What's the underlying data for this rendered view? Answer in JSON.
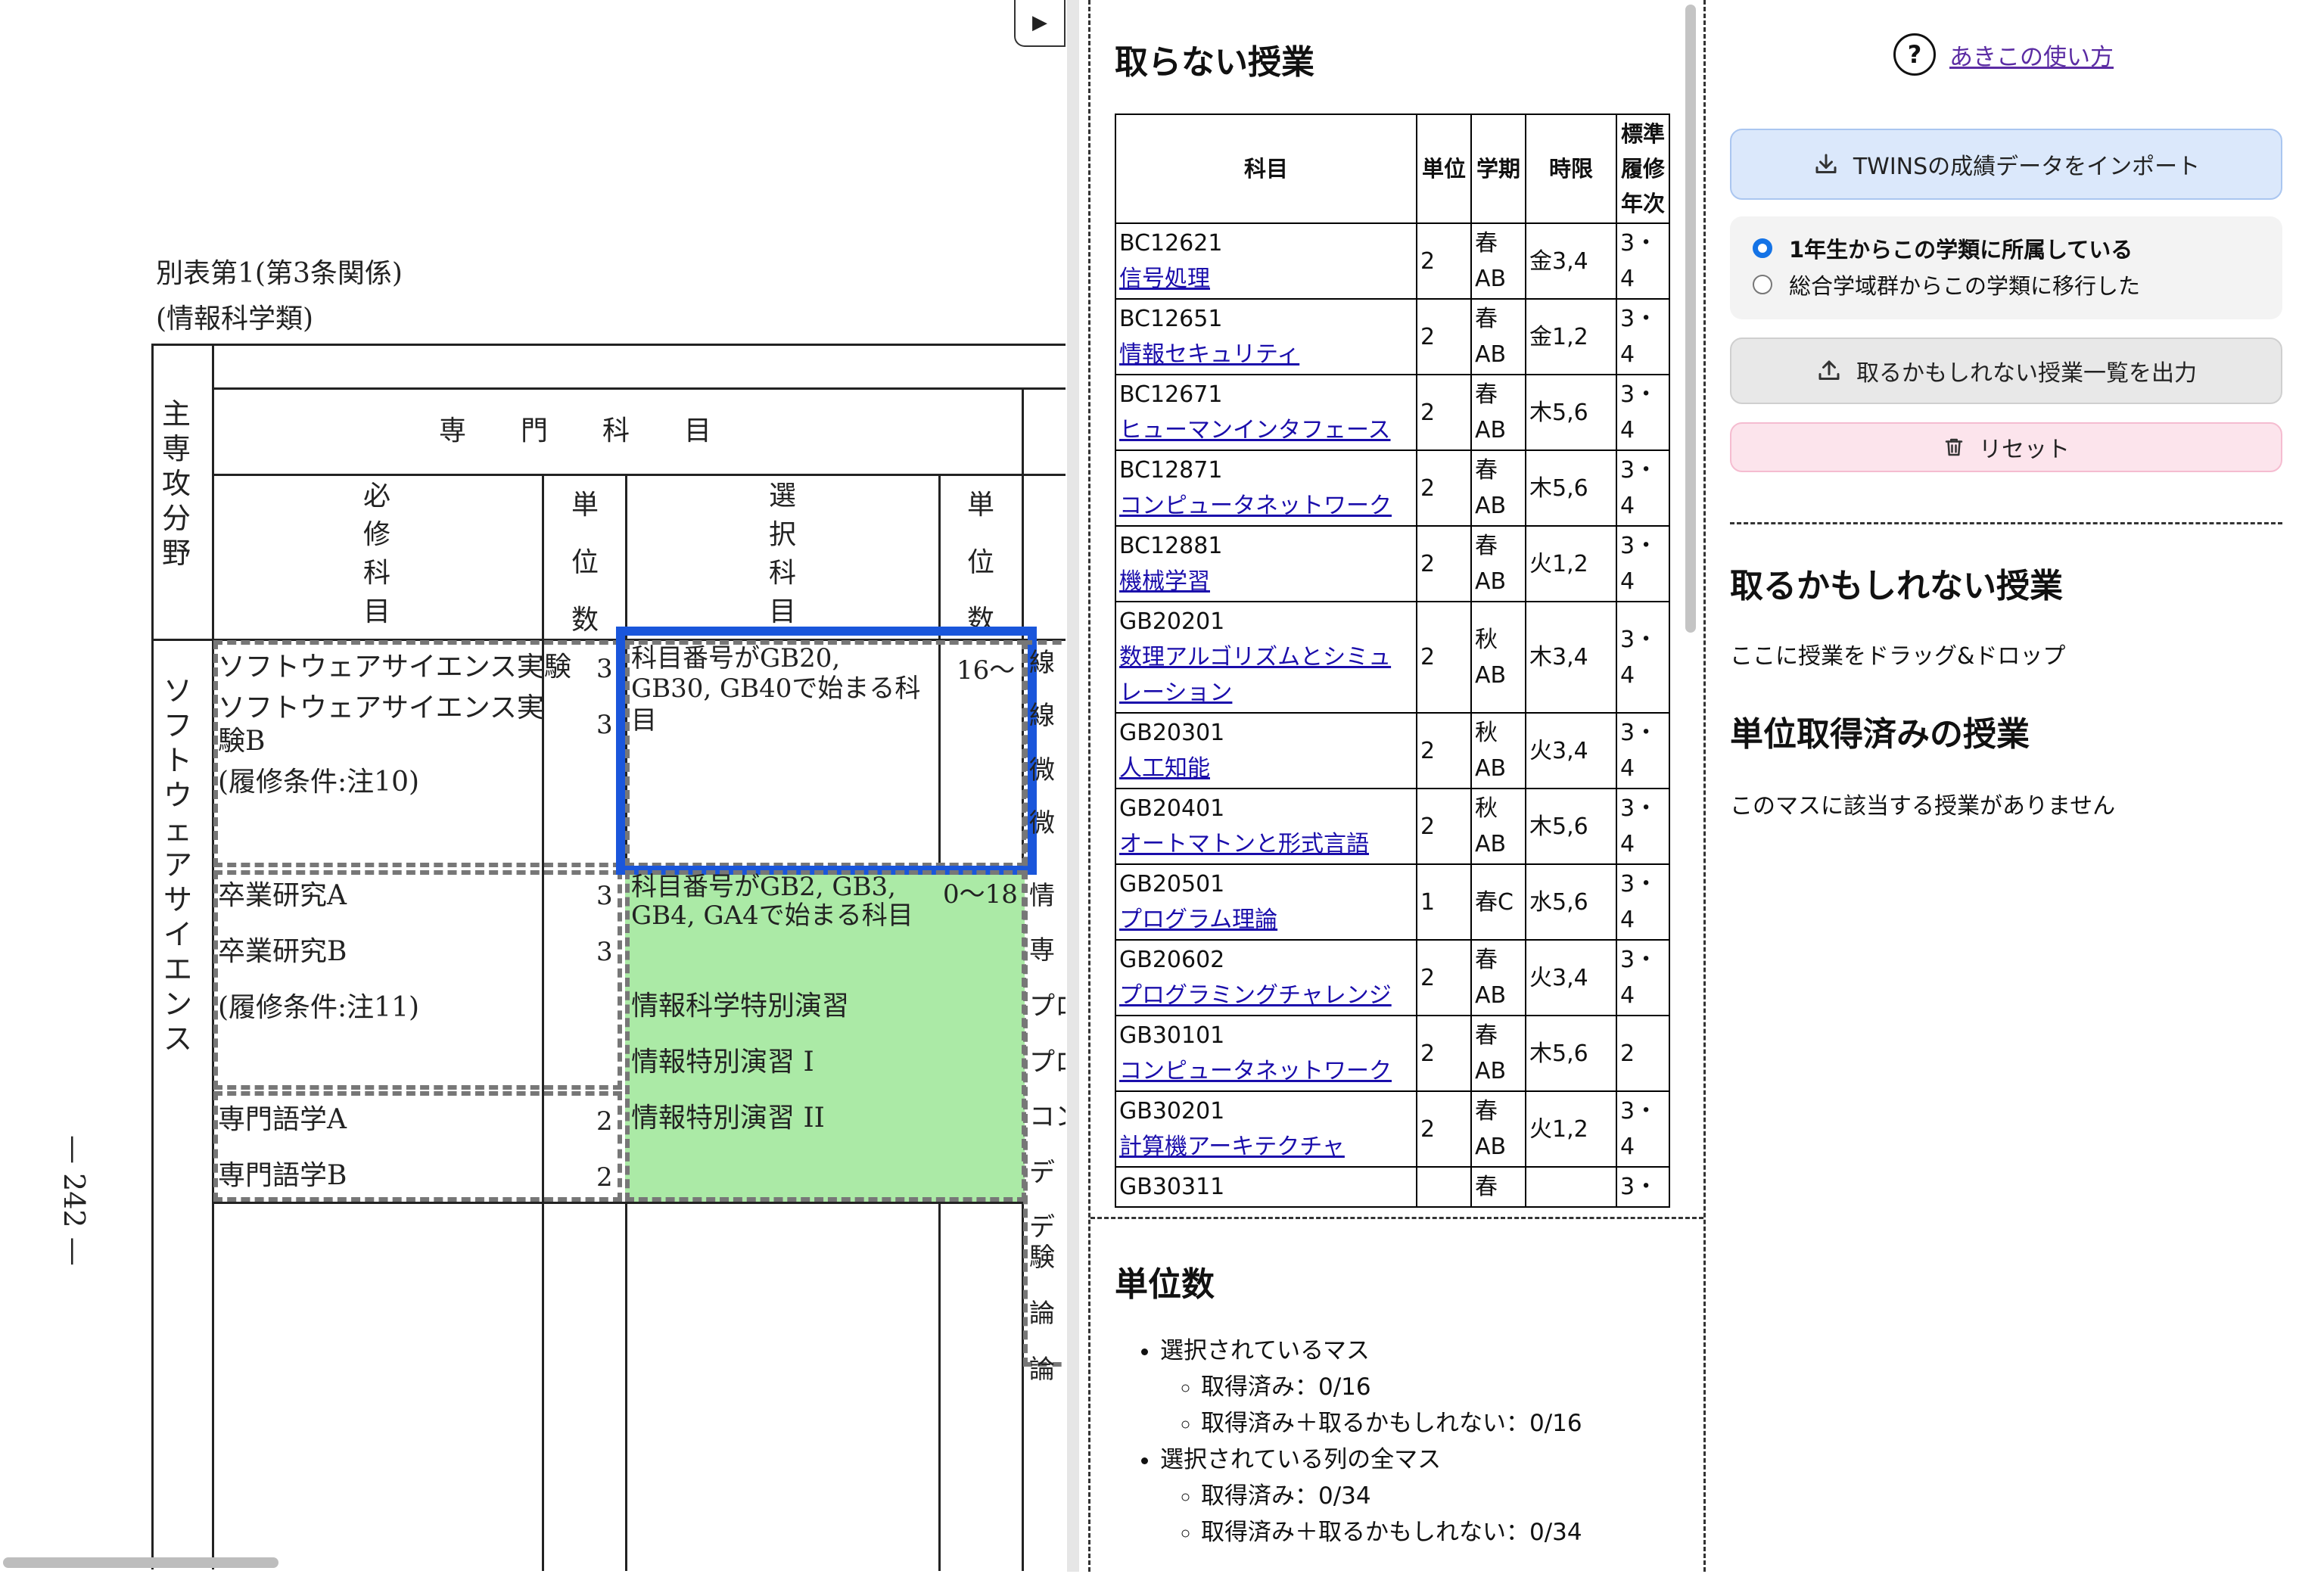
{
  "document": {
    "caption_line1": "別表第1(第3条関係)",
    "caption_line2": "(情報科学類)",
    "header_major": "主専攻分野",
    "header_specialized": "専　　門　　科　　目",
    "header_required": "必修科目",
    "header_units": "単位数",
    "header_elective": "選択科目",
    "major_name": "ソフトウェアサイエンス",
    "page_number": "— 242 —",
    "required_row1": {
      "line1": "ソフトウェアサイエンス実験",
      "line2": "ソフトウェアサイエンス実",
      "line3": "験B",
      "condition": "(履修条件:注10)",
      "units1": "3",
      "units2": "3"
    },
    "required_row2": {
      "line1": "卒業研究A",
      "line2": "卒業研究B",
      "condition": "(履修条件:注11)",
      "units1": "3",
      "units2": "3"
    },
    "required_row3": {
      "line1": "専門語学A",
      "line2": "専門語学B",
      "units1": "2",
      "units2": "2"
    },
    "elective_row1": {
      "line1": "科目番号がGB20,",
      "line2": "GB30, GB40で始まる科",
      "line3": "目",
      "units": "16〜"
    },
    "elective_row2": {
      "line1": "科目番号がGB2, GB3,",
      "line2": "GB4, GA4で始まる科目",
      "line3": "情報科学特別演習",
      "line4": "情報特別演習 I",
      "line5": "情報特別演習 II",
      "units": "0〜18"
    },
    "clipped_col": [
      "線",
      "線",
      "微",
      "微",
      "情",
      "専",
      "プロ",
      "プロ",
      "コン",
      "デ",
      "デ",
      "験",
      "論",
      "論"
    ],
    "collapse_glyph": "▶"
  },
  "untaken": {
    "title": "取らない授業",
    "headers": [
      "科目",
      "単位",
      "学期",
      "時限",
      "標準",
      "履修",
      "年次"
    ],
    "rows": [
      {
        "code": "BC12621",
        "name": "信号処理",
        "units": "2",
        "term1": "春",
        "term2": "AB",
        "period": "金3,4",
        "year1": "3・",
        "year2": "4"
      },
      {
        "code": "BC12651",
        "name": "情報セキュリティ",
        "units": "2",
        "term1": "春",
        "term2": "AB",
        "period": "金1,2",
        "year1": "3・",
        "year2": "4"
      },
      {
        "code": "BC12671",
        "name": "ヒューマンインタフェース",
        "units": "2",
        "term1": "春",
        "term2": "AB",
        "period": "木5,6",
        "year1": "3・",
        "year2": "4"
      },
      {
        "code": "BC12871",
        "name": "コンピュータネットワーク",
        "units": "2",
        "term1": "春",
        "term2": "AB",
        "period": "木5,6",
        "year1": "3・",
        "year2": "4"
      },
      {
        "code": "BC12881",
        "name": "機械学習",
        "units": "2",
        "term1": "春",
        "term2": "AB",
        "period": "火1,2",
        "year1": "3・",
        "year2": "4"
      },
      {
        "code": "GB20201",
        "name": "数理アルゴリズムとシミュ",
        "name2": "レーション",
        "units": "2",
        "term1": "秋",
        "term2": "AB",
        "period": "木3,4",
        "year1": "3・",
        "year2": "4"
      },
      {
        "code": "GB20301",
        "name": "人工知能",
        "units": "2",
        "term1": "秋",
        "term2": "AB",
        "period": "火3,4",
        "year1": "3・",
        "year2": "4"
      },
      {
        "code": "GB20401",
        "name": "オートマトンと形式言語",
        "units": "2",
        "term1": "秋",
        "term2": "AB",
        "period": "木5,6",
        "year1": "3・",
        "year2": "4"
      },
      {
        "code": "GB20501",
        "name": "プログラム理論",
        "units": "1",
        "term1": "春C",
        "term2": "",
        "period": "水5,6",
        "year1": "3・",
        "year2": "4"
      },
      {
        "code": "GB20602",
        "name": "プログラミングチャレンジ",
        "units": "2",
        "term1": "春",
        "term2": "AB",
        "period": "火3,4",
        "year1": "3・",
        "year2": "4"
      },
      {
        "code": "GB30101",
        "name": "コンピュータネットワーク",
        "units": "2",
        "term1": "春",
        "term2": "AB",
        "period": "木5,6",
        "year1": "2",
        "year2": ""
      },
      {
        "code": "GB30201",
        "name": "計算機アーキテクチャ",
        "units": "2",
        "term1": "春",
        "term2": "AB",
        "period": "火1,2",
        "year1": "3・",
        "year2": "4"
      },
      {
        "code": "GB30311",
        "name": "",
        "units": "",
        "term1": "春",
        "term2": "",
        "period": "",
        "year1": "3・",
        "year2": ""
      }
    ]
  },
  "units_summary": {
    "title": "単位数",
    "selected_cell": "選択されているマス",
    "selected_earned": "取得済み：0/16",
    "selected_maybe": "取得済み＋取るかもしれない：0/16",
    "column_all": "選択されている列の全マス",
    "column_earned": "取得済み：0/34",
    "column_maybe": "取得済み＋取るかもしれない：0/34"
  },
  "sidebar": {
    "help_icon": "?",
    "help_link": "あきこの使い方",
    "import_label": "TWINSの成績データをインポート",
    "radio_first_year": "1年生からこの学類に所属している",
    "radio_transfer": "総合学域群からこの学類に移行した",
    "export_label": "取るかもしれない授業一覧を出力",
    "reset_label": "リセット",
    "maybe_title": "取るかもしれない授業",
    "maybe_hint": "ここに授業をドラッグ&ドロップ",
    "earned_title": "単位取得済みの授業",
    "earned_empty": "このマスに該当する授業がありません"
  },
  "colors": {
    "selection": "#1a56db",
    "green_cell": "#abeaa6",
    "link": "#1a0dab",
    "import_bg": "#dbe8fb",
    "reset_bg": "#fce4ec"
  }
}
